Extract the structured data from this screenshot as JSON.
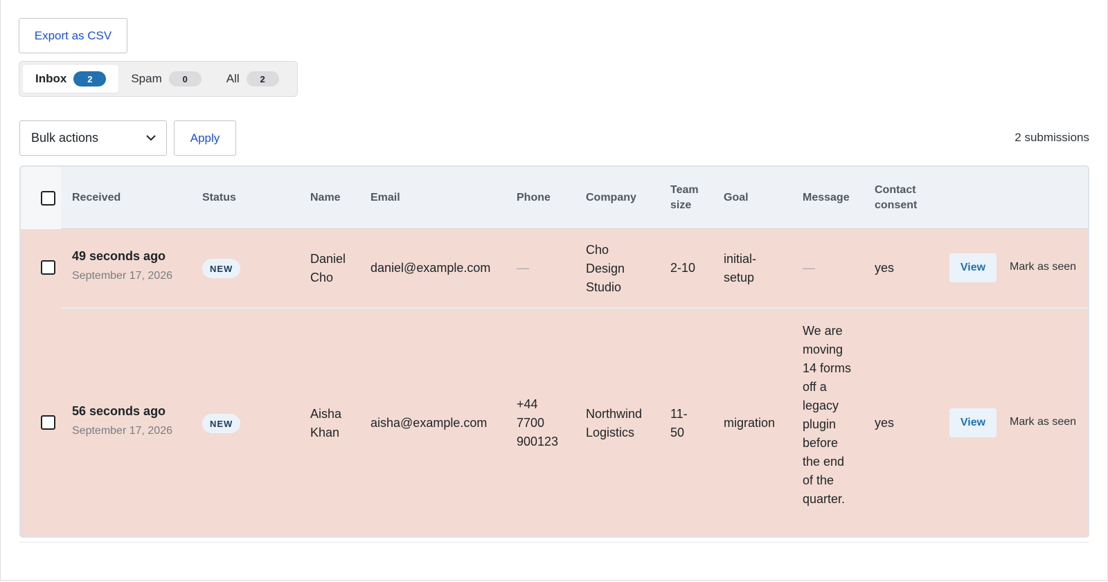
{
  "toolbar": {
    "export_label": "Export as CSV",
    "bulk_actions_label": "Bulk actions",
    "apply_label": "Apply",
    "submissions_count_text": "2 submissions"
  },
  "tabs": [
    {
      "label": "Inbox",
      "count": "2",
      "active": true
    },
    {
      "label": "Spam",
      "count": "0",
      "active": false
    },
    {
      "label": "All",
      "count": "2",
      "active": false
    }
  ],
  "table": {
    "headers": {
      "received": "Received",
      "status": "Status",
      "name": "Name",
      "email": "Email",
      "phone": "Phone",
      "company": "Company",
      "team_size": "Team size",
      "goal": "Goal",
      "message": "Message",
      "contact_consent": "Contact consent"
    },
    "rows": [
      {
        "received_relative": "49 seconds ago",
        "received_date": "September 17, 2026",
        "status": "NEW",
        "name": "Daniel Cho",
        "email": "daniel@example.com",
        "phone": "—",
        "company": "Cho Design Studio",
        "team_size": "2-10",
        "goal": "initial-setup",
        "message": "—",
        "contact_consent": "yes",
        "view_label": "View",
        "mark_label": "Mark as seen"
      },
      {
        "received_relative": "56 seconds ago",
        "received_date": "September 17, 2026",
        "status": "NEW",
        "name": "Aisha Khan",
        "email": "aisha@example.com",
        "phone": "+44 7700 900123",
        "company": "Northwind Logistics",
        "team_size": "11-50",
        "goal": "migration",
        "message": "We are moving 14 forms off a legacy plugin before the end of the quarter.",
        "contact_consent": "yes",
        "view_label": "View",
        "mark_label": "Mark as seen"
      }
    ]
  },
  "colors": {
    "accent": "#2271b1",
    "link": "#1d4fd8",
    "row_highlight": "#f3dbd3",
    "header_bg": "#eef2f6"
  }
}
